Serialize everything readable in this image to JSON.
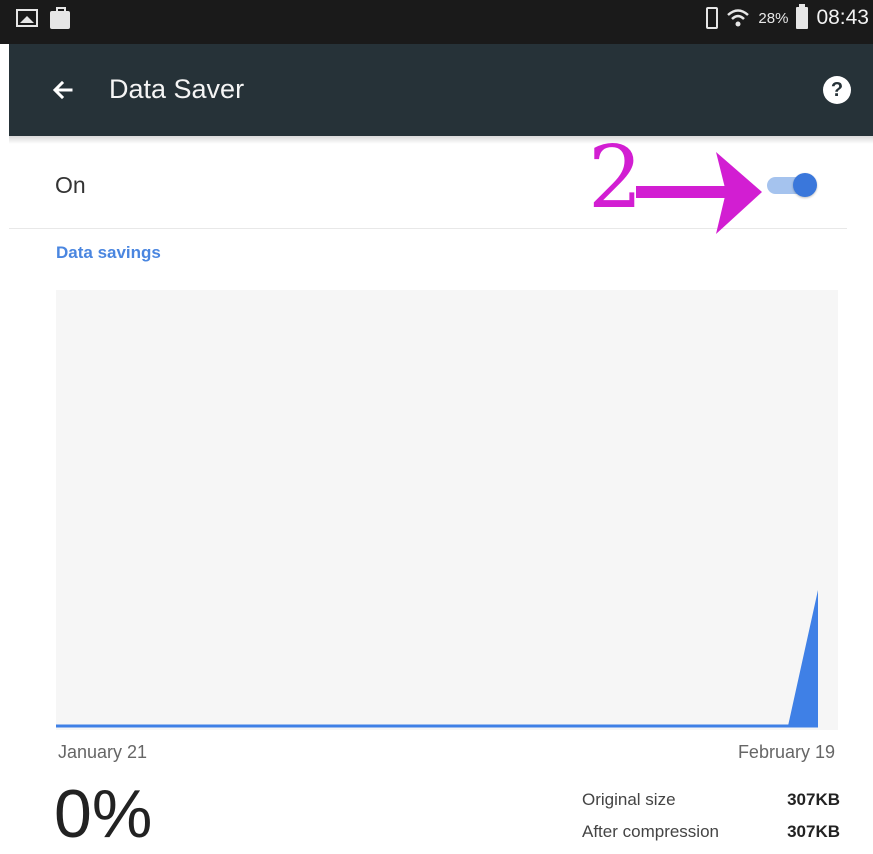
{
  "status_bar": {
    "battery_percent": "28%",
    "time": "08:43"
  },
  "app_bar": {
    "title": "Data Saver",
    "help_symbol": "?"
  },
  "switch": {
    "label": "On",
    "state": "on"
  },
  "annotation": {
    "number": "2"
  },
  "data_savings": {
    "header": "Data savings",
    "start_date": "January 21",
    "end_date": "February 19",
    "percent": "0%",
    "original_label": "Original size",
    "original_value": "307KB",
    "compressed_label": "After compression",
    "compressed_value": "307KB"
  },
  "chart_data": {
    "type": "area",
    "x_start": "January 21",
    "x_end": "February 19",
    "x": [
      "January 21",
      "February 19"
    ],
    "values": [
      0,
      307
    ],
    "unit": "KB",
    "grid": false,
    "color": "#3f80e6"
  },
  "colors": {
    "app_bar": "#263238",
    "accent": "#3a77db",
    "annotation": "#d21ed2"
  }
}
